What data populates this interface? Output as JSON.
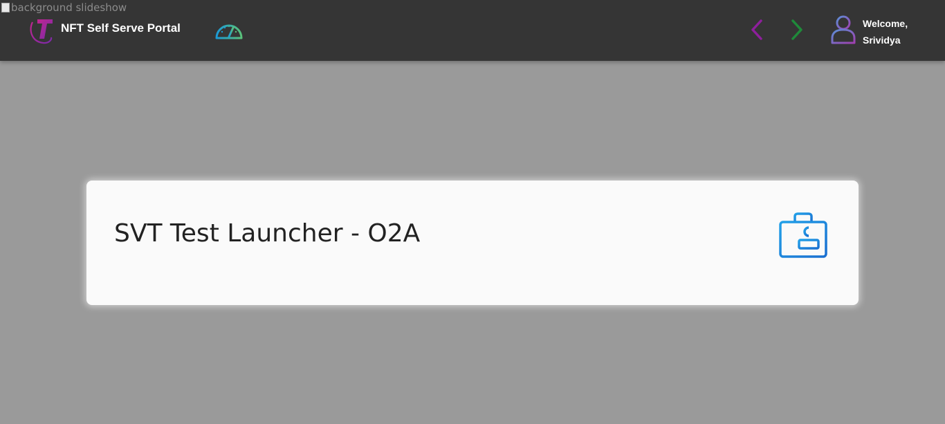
{
  "background": {
    "alt_text": "background slideshow"
  },
  "header": {
    "brand": "NFT Self Serve Portal",
    "welcome_line1": "Welcome,",
    "welcome_line2": "Srividya",
    "icons": {
      "logo": "telstra-logo-icon",
      "dashboard": "speedometer-gauge-icon",
      "prev": "chevron-left-icon",
      "next": "chevron-right-icon",
      "user": "user-avatar-icon"
    }
  },
  "main": {
    "card_title": "SVT Test Launcher - O2A",
    "card_icon": "toolbox-icon"
  },
  "colors": {
    "header_bg": "#353535",
    "page_bg": "#9a9a9a",
    "prev_arrow": "#8e1f9c",
    "next_arrow": "#1f8a3a",
    "card_icon": "#1e88e5",
    "logo": "#a2238f"
  }
}
